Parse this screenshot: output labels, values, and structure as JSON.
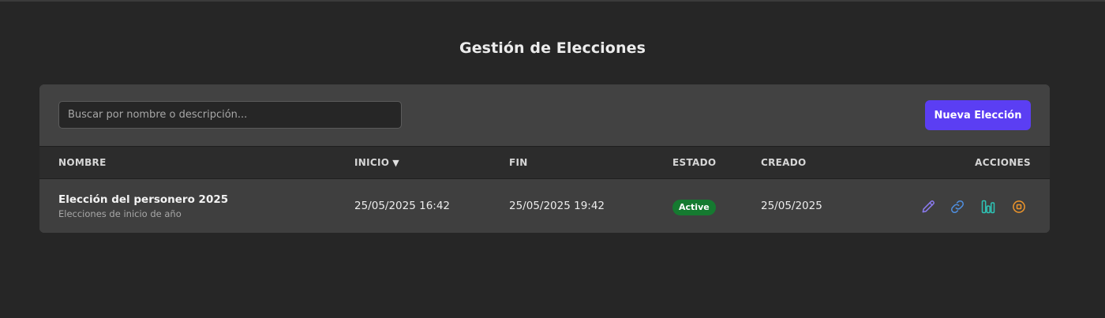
{
  "page": {
    "title": "Gestión de Elecciones"
  },
  "toolbar": {
    "search_placeholder": "Buscar por nombre o descripción...",
    "new_button_label": "Nueva Elección"
  },
  "table": {
    "columns": {
      "name": "NOMBRE",
      "start": "INICIO",
      "end": "FIN",
      "status": "ESTADO",
      "created": "CREADO",
      "actions": "ACCIONES"
    },
    "sort": {
      "column": "start",
      "indicator": "▼"
    },
    "rows": [
      {
        "name": "Elección del personero 2025",
        "description": "Elecciones de inicio de año",
        "start": "25/05/2025 16:42",
        "end": "25/05/2025 19:42",
        "status": "Active",
        "created": "25/05/2025",
        "actions": [
          "edit-icon",
          "link-icon",
          "results-icon",
          "stop-icon"
        ]
      }
    ]
  },
  "colors": {
    "background": "#262626",
    "card": "#3f3f3f",
    "primary": "#5b3ef3",
    "status_active": "#157a30",
    "edit": "#8b7bf0",
    "link": "#4f8fe0",
    "results": "#2ec4b6",
    "stop": "#f0962a"
  }
}
